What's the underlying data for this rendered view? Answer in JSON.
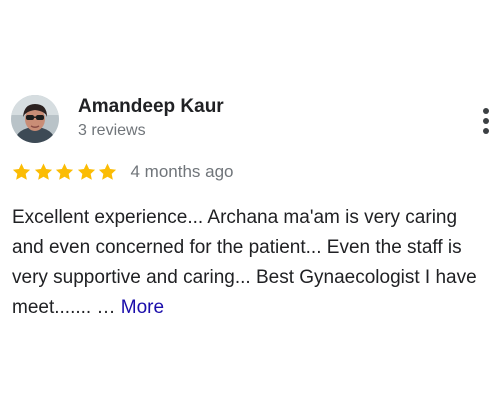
{
  "reviewer": {
    "name": "Amandeep Kaur",
    "subtitle": "3 reviews",
    "avatar_icon": "user-photo"
  },
  "menu": {
    "icon": "more-vert-icon"
  },
  "rating": {
    "stars": 5,
    "max_stars": 5,
    "star_color": "#fbbc04",
    "time": "4 months ago"
  },
  "review": {
    "text": "Excellent experience... Archana ma'am is very caring and even concerned for the patient... Even the staff is very supportive and caring... Best Gynaecologist I have meet....... …",
    "more_label": "More",
    "link_color": "#1a0dab"
  }
}
